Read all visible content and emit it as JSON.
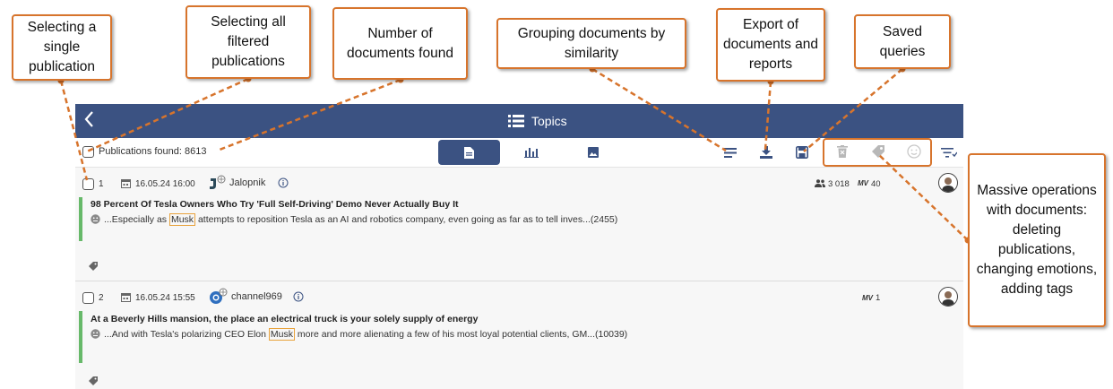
{
  "header": {
    "title": "Topics",
    "back_icon": "chevron-left-icon"
  },
  "toolbar": {
    "found_label": "Publications found: 8613",
    "view_tabs": [
      {
        "icon": "document-icon",
        "active": true
      },
      {
        "icon": "bar-chart-icon",
        "active": false
      },
      {
        "icon": "image-icon",
        "active": false
      }
    ],
    "tools": [
      "group-similar-icon",
      "export-icon",
      "save-query-icon"
    ],
    "mass_tools": [
      "delete-icon",
      "tag-icon",
      "emotion-icon"
    ],
    "filter_icon": "filter-sort-icon"
  },
  "items": [
    {
      "num": "1",
      "datetime": "16.05.24 16:00",
      "source": "Jalopnik",
      "audience": "3 018",
      "mv_label": "MV",
      "mv": "40",
      "headline": "98 Percent Of Tesla Owners Who Try 'Full Self-Driving' Demo Never Actually Buy It",
      "snippet_pre": "...Especially as ",
      "snippet_hl": "Musk",
      "snippet_post": " attempts to reposition Tesla as an AI and robotics company, even going as far as to tell inves...(2455)"
    },
    {
      "num": "2",
      "datetime": "16.05.24 15:55",
      "source": "channel969",
      "audience": "",
      "mv_label": "MV",
      "mv": "1",
      "headline": "At a Beverly Hills mansion, the place an electrical truck is your solely supply of energy",
      "snippet_pre": "...And with Tesla's polarizing CEO Elon ",
      "snippet_hl": "Musk",
      "snippet_post": " more and more alienating a few of his most loyal potential clients, GM...(10039)"
    }
  ],
  "callouts": {
    "select_single": "Selecting a single publication",
    "select_all": "Selecting all filtered publications",
    "number_found": "Number of documents found",
    "grouping": "Grouping documents by similarity",
    "export": "Export of documents and reports",
    "saved": "Saved queries",
    "massive": "Massive operations with documents: deleting publications, changing emotions, adding tags"
  },
  "colors": {
    "header": "#3b5282",
    "callout_border": "#d7742c",
    "green_marker": "#67b96a",
    "highlight": "#e8a33d"
  }
}
